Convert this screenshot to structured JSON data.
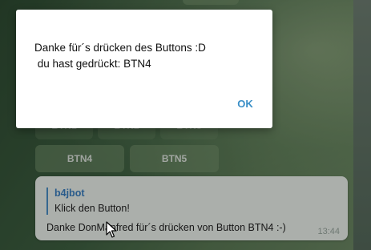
{
  "keyboard": {
    "row1": [
      "BTN1",
      "BTN2",
      "BTN3"
    ],
    "row2": [
      "BTN4",
      "BTN5"
    ]
  },
  "message": {
    "reply_author": "b4jbot",
    "reply_text": "Klick den Button!",
    "text": "Danke DonManfred für´s drücken von Button BTN4 :-)",
    "time": "13:44"
  },
  "dialog": {
    "line1": "Danke für´s drücken des Buttons :D",
    "line2": " du hast gedrückt: BTN4",
    "ok_label": "OK"
  },
  "colors": {
    "link_blue": "#3a8fc7",
    "bubble_bg": "#eef3ee"
  }
}
